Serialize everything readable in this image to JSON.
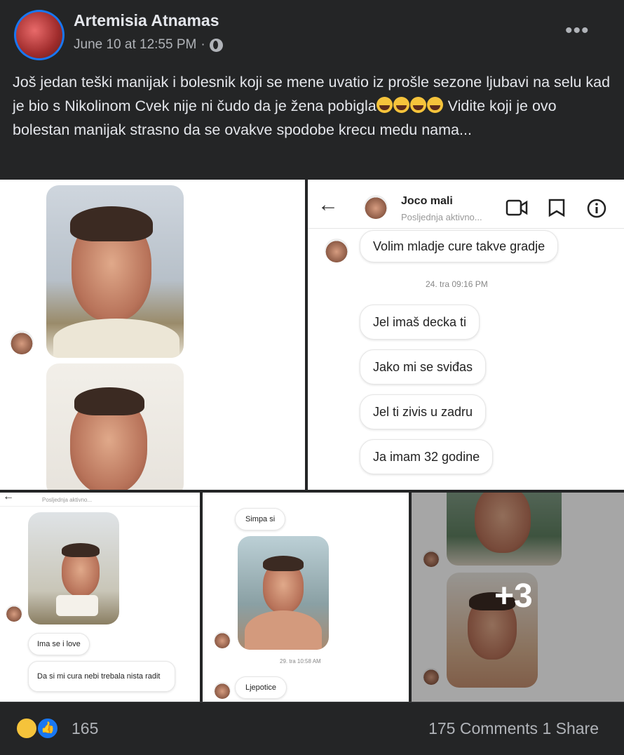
{
  "post": {
    "author": "Artemisia Atnamas",
    "timestamp": "June 10 at 12:55 PM",
    "separator": "·",
    "privacy_icon": "globe-icon",
    "more_icon": "more-icon",
    "text_before": "Još jedan teški manijak i bolesnik koji se mene uvatio iz prošle sezone ljubavi na selu kad je bio s Nikolinom Cvek nije ni čudo da je žena pobigla",
    "text_after": " Vidite koji je ovo bolestan manijak strasno da se ovakve spodobe krecu medu nama..."
  },
  "chat": {
    "contact_name": "Joco mali",
    "contact_status": "Posljednja aktivno...",
    "messages_top": [
      "Volim mladje cure takve gradje"
    ],
    "timestamp": "24. tra 09:16 PM",
    "messages": [
      "Jel imaš decka ti",
      "Jako mi se sviđas",
      "Jel ti zivis u zadru",
      "Ja imam 32 godine"
    ]
  },
  "tile3": {
    "status": "Posljednja aktivno...",
    "messages": [
      "Ima se i love",
      "Da si mi cura nebi trebala nista radit"
    ]
  },
  "tile4": {
    "messages": [
      "Simpa si"
    ],
    "timestamp": "29. tra 10:58 AM",
    "last": "Ljepotice"
  },
  "tile5": {
    "more_count": "+3"
  },
  "footer": {
    "reactions_count": "165",
    "comments": "175 Comments",
    "shares": "1 Share",
    "reaction_icons": [
      "laughing-emoji-icon",
      "like-icon"
    ]
  }
}
